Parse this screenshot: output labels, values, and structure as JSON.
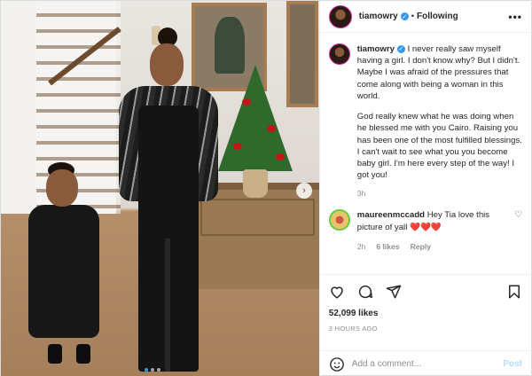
{
  "post": {
    "username": "tiamowry",
    "separator": "•",
    "follow_status": "Following",
    "more": "•••",
    "caption": [
      "I never really saw myself having a girl. I don't know why? But I didn't. Maybe I was afraid of the pressures that come along with being a woman in this world.",
      "God really knew what he was doing when he blessed me with you Cairo. Raising you has been one of the most fulfilled blessings. I can't wait to see what you you become baby girl. I'm here every step of the way! I got you!"
    ],
    "caption_time": "3h",
    "comment": {
      "username": "maureenmccadd",
      "text": "Hey Tia love this picture of yall",
      "emoji": "❤️❤️❤️",
      "time": "2h",
      "likes": "6 likes",
      "reply": "Reply"
    },
    "likes": "52,099 likes",
    "posted_ago": "3 HOURS AGO",
    "add_comment_placeholder": "Add a comment...",
    "post_button": "Post"
  },
  "colors": {
    "verified": "#3897f0",
    "accent_link": "#b3dbff",
    "heart": "#ed4956"
  },
  "icons": [
    "verified-icon",
    "more-icon",
    "heart-icon",
    "comment-icon",
    "share-icon",
    "bookmark-icon",
    "emoji-icon",
    "carousel-next-icon"
  ]
}
